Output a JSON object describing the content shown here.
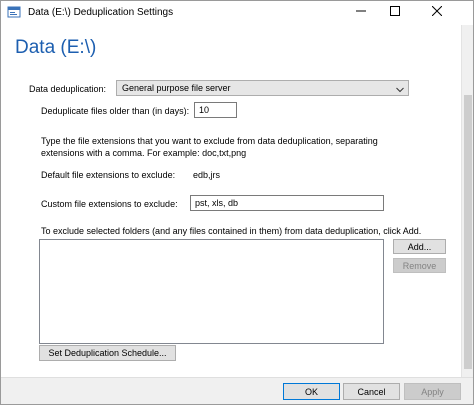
{
  "window": {
    "title": "Data (E:\\) Deduplication Settings"
  },
  "page": {
    "heading": "Data (E:\\)"
  },
  "dedup": {
    "label": "Data deduplication:",
    "selected": "General purpose file server"
  },
  "older_than": {
    "label": "Deduplicate files older than (in days):",
    "value": "10"
  },
  "exclude_help": {
    "line1": "Type the file extensions that you want to exclude from data deduplication, separating",
    "line2": "extensions with a comma. For example: doc,txt,png"
  },
  "default_ext": {
    "label": "Default file extensions to exclude:",
    "value": "edb,jrs"
  },
  "custom_ext": {
    "label": "Custom file extensions to exclude:",
    "value": "pst, xls, db"
  },
  "folders": {
    "help": "To exclude selected folders (and any files contained in them) from data deduplication, click Add.",
    "add_label": "Add...",
    "remove_label": "Remove",
    "items": []
  },
  "schedule": {
    "button_label": "Set Deduplication Schedule..."
  },
  "footer": {
    "ok_label": "OK",
    "cancel_label": "Cancel",
    "apply_label": "Apply"
  },
  "colors": {
    "heading": "#1d5fb0",
    "primary_border": "#0078d7"
  },
  "icons": {
    "app": "settings-window-icon",
    "minimize": "minimize-icon",
    "maximize": "maximize-icon",
    "close": "close-icon",
    "dropdown": "chevron-down-icon"
  }
}
